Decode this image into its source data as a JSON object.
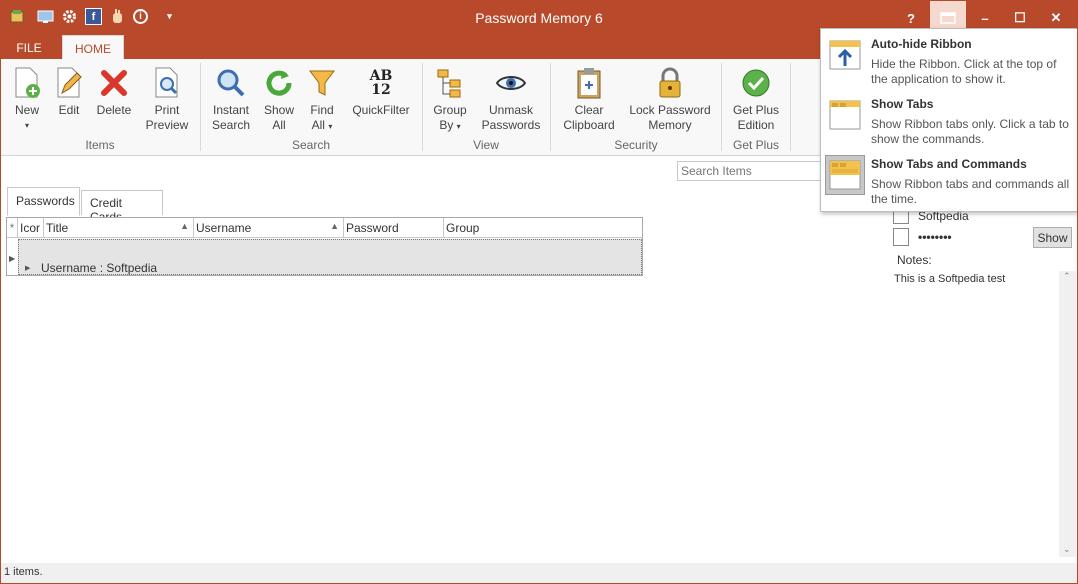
{
  "app": {
    "title": "Password Memory 6"
  },
  "quick_access": [
    "app-icon",
    "monitor-icon",
    "gear-icon",
    "facebook-icon",
    "hand-icon",
    "info-icon",
    "dropdown-icon"
  ],
  "window_buttons": {
    "help": "?",
    "ribbon_display": "ribbon-display-icon",
    "minimize": "–",
    "maximize": "☐",
    "close": "✕"
  },
  "ribbon_tabs": [
    {
      "label": "FILE"
    },
    {
      "label": "HOME"
    }
  ],
  "ribbon": {
    "items": {
      "group_label": "Items",
      "new_line1": "New",
      "edit": "Edit",
      "delete": "Delete",
      "print_line1": "Print",
      "print_line2": "Preview"
    },
    "search": {
      "group_label": "Search",
      "instant_line1": "Instant",
      "instant_line2": "Search",
      "showall_line1": "Show",
      "showall_line2": "All",
      "findall_line1": "Find",
      "findall_line2": "All",
      "quickfilter": "QuickFilter",
      "qf_icon_top": "AB",
      "qf_icon_bottom": "12"
    },
    "view": {
      "group_label": "View",
      "groupby_line1": "Group",
      "groupby_line2": "By",
      "unmask_line1": "Unmask",
      "unmask_line2": "Passwords"
    },
    "security": {
      "group_label": "Security",
      "clear_line1": "Clear",
      "clear_line2": "Clipboard",
      "lock_line1": "Lock Password",
      "lock_line2": "Memory"
    },
    "getplus": {
      "group_label": "Get Plus",
      "line1": "Get Plus",
      "line2": "Edition"
    }
  },
  "search_box": {
    "placeholder": "Search Items"
  },
  "data_tabs": [
    {
      "label": "Passwords"
    },
    {
      "label": "Credit Cards"
    }
  ],
  "grid": {
    "columns": [
      "Icor",
      "Title",
      "Username",
      "Password",
      "Group"
    ],
    "group_row": "Username : Softpedia",
    "new_row_marker": "*"
  },
  "detail": {
    "username": "Softpedia",
    "password_masked": "••••••••",
    "show_button": "Show",
    "notes_label": "Notes:",
    "notes_text": "This is a Softpedia test"
  },
  "status": {
    "text": "1 items."
  },
  "ribbon_options_popup": [
    {
      "title": "Auto-hide Ribbon",
      "desc": "Hide the Ribbon. Click at the top of the application to show it.",
      "active": false
    },
    {
      "title": "Show Tabs",
      "desc": "Show Ribbon tabs only. Click a tab to show the commands.",
      "active": false
    },
    {
      "title": "Show Tabs and Commands",
      "desc": "Show Ribbon tabs and commands all the time.",
      "active": true
    }
  ],
  "colors": {
    "title_bar": "#b84a2b",
    "ribbon_bg": "#f8f8f8",
    "group_highlight": "#e4e4e4"
  }
}
